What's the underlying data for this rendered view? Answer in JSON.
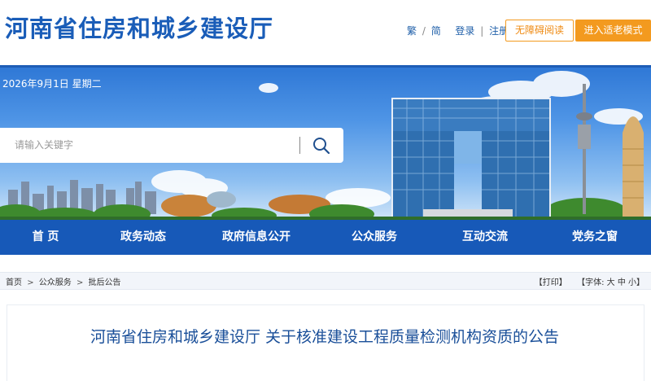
{
  "header": {
    "site_title": "河南省住房和城乡建设厅",
    "links": {
      "traditional": "繁",
      "simplified": "简",
      "login": "登录",
      "register": "注册"
    },
    "accessible_btn": "无障碍阅读",
    "elder_btn": "进入适老模式"
  },
  "banner": {
    "date": "2026年9月1日 星期二",
    "search_placeholder": "请输入关键字"
  },
  "nav": {
    "items": [
      {
        "label": "首  页"
      },
      {
        "label": "政务动态"
      },
      {
        "label": "政府信息公开"
      },
      {
        "label": "公众服务"
      },
      {
        "label": "互动交流"
      },
      {
        "label": "党务之窗"
      }
    ]
  },
  "breadcrumb": {
    "items": [
      "首页",
      "公众服务",
      "批后公告"
    ],
    "separator": ">",
    "print": "【打印】",
    "font_size": "【字体: 大 中 小】"
  },
  "article": {
    "title": "河南省住房和城乡建设厅 关于核准建设工程质量检测机构资质的公告"
  },
  "colors": {
    "brand_blue": "#1759b8",
    "orange": "#f39a1f"
  }
}
